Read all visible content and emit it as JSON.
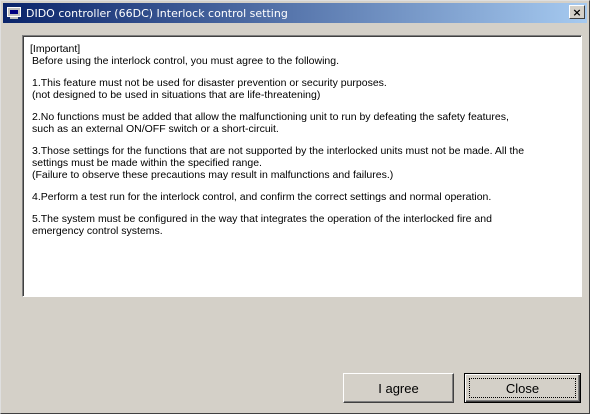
{
  "window": {
    "title": "DIDO controller (66DC) Interlock control setting",
    "close_symbol": "×"
  },
  "notice": {
    "heading": "[Important]",
    "intro": "Before using the interlock control, you must agree to the following.",
    "items": [
      {
        "lines": [
          "1.This feature must not be used for disaster prevention or security purposes.",
          "(not designed to be used in situations that are life-threatening)"
        ]
      },
      {
        "lines": [
          "2.No functions must be added that allow the malfunctioning unit to run by defeating the safety features,",
          "such as an external ON/OFF switch or a short-circuit."
        ]
      },
      {
        "lines": [
          "3.Those settings for the functions that are not supported by the interlocked units must not be made. All the",
          "settings must be made within the specified range.",
          "(Failure to observe these precautions may result in malfunctions and failures.)"
        ]
      },
      {
        "lines": [
          "4.Perform a test run for the interlock control, and confirm the correct settings and normal operation."
        ]
      },
      {
        "lines": [
          "5.The system must be configured in the way that integrates the operation of the interlocked fire and",
          "emergency control systems."
        ]
      }
    ]
  },
  "buttons": {
    "agree_label": "I agree",
    "close_label": "Close"
  }
}
